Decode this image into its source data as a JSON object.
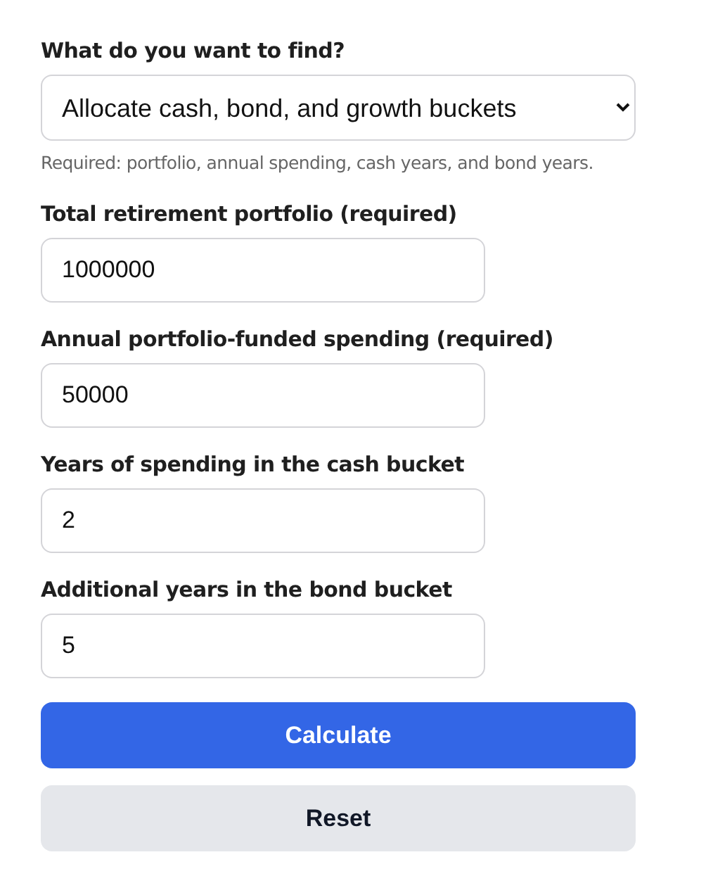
{
  "goal": {
    "label": "What do you want to find?",
    "value": "Allocate cash, bond, and growth buckets",
    "hint": "Required: portfolio, annual spending, cash years, and bond years."
  },
  "fields": [
    {
      "label": "Total retirement portfolio (required)",
      "value": "1000000"
    },
    {
      "label": "Annual portfolio-funded spending (required)",
      "value": "50000"
    },
    {
      "label": "Years of spending in the cash bucket",
      "value": "2"
    },
    {
      "label": "Additional years in the bond bucket",
      "value": "5"
    }
  ],
  "buttons": [
    {
      "label": "Calculate",
      "kind": "primary"
    },
    {
      "label": "Reset",
      "kind": "secondary"
    }
  ]
}
